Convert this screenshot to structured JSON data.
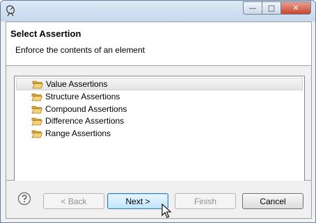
{
  "header": {
    "title": "Select Assertion",
    "subtitle": "Enforce the contents of an element"
  },
  "tree": {
    "items": [
      {
        "label": "Value Assertions",
        "icon": "folder-open-icon",
        "selected": true
      },
      {
        "label": "Structure Assertions",
        "icon": "folder-open-icon",
        "selected": false
      },
      {
        "label": "Compound Assertions",
        "icon": "folder-open-icon",
        "selected": false
      },
      {
        "label": "Difference Assertions",
        "icon": "folder-open-icon",
        "selected": false
      },
      {
        "label": "Range Assertions",
        "icon": "folder-open-icon",
        "selected": false
      }
    ]
  },
  "buttons": {
    "back": "< Back",
    "next": "Next >",
    "finish": "Finish",
    "cancel": "Cancel"
  },
  "window_controls": {
    "minimize": "—",
    "maximize": "□",
    "close": "✕"
  },
  "colors": {
    "titlebar": "#c7d8ec",
    "close_button": "#c8452f",
    "default_button": "#bee6fd",
    "folder": "#e8b84a"
  }
}
